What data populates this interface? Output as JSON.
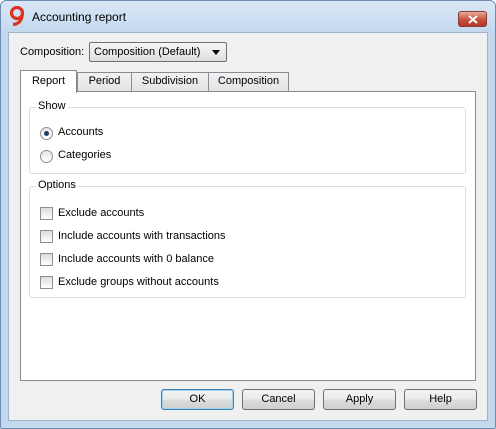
{
  "window": {
    "title": "Accounting report",
    "app_icon": "nine-logo-icon",
    "close_icon": "close-icon"
  },
  "composition": {
    "label": "Composition:",
    "selected": "Composition (Default)"
  },
  "tabs": [
    {
      "label": "Report",
      "active": true
    },
    {
      "label": "Period",
      "active": false
    },
    {
      "label": "Subdivision",
      "active": false
    },
    {
      "label": "Composition",
      "active": false
    }
  ],
  "show": {
    "title": "Show",
    "options": [
      {
        "label": "Accounts",
        "selected": true
      },
      {
        "label": "Categories",
        "selected": false
      }
    ]
  },
  "options": {
    "title": "Options",
    "items": [
      {
        "label": "Exclude accounts",
        "checked": false
      },
      {
        "label": "Include accounts with transactions",
        "checked": false
      },
      {
        "label": "Include accounts with 0 balance",
        "checked": false
      },
      {
        "label": "Exclude groups without accounts",
        "checked": false
      }
    ]
  },
  "buttons": {
    "ok": "OK",
    "cancel": "Cancel",
    "apply": "Apply",
    "help": "Help"
  },
  "colors": {
    "frame": "#c4d9ef",
    "close": "#c7513f",
    "logo": "#e0301e"
  }
}
